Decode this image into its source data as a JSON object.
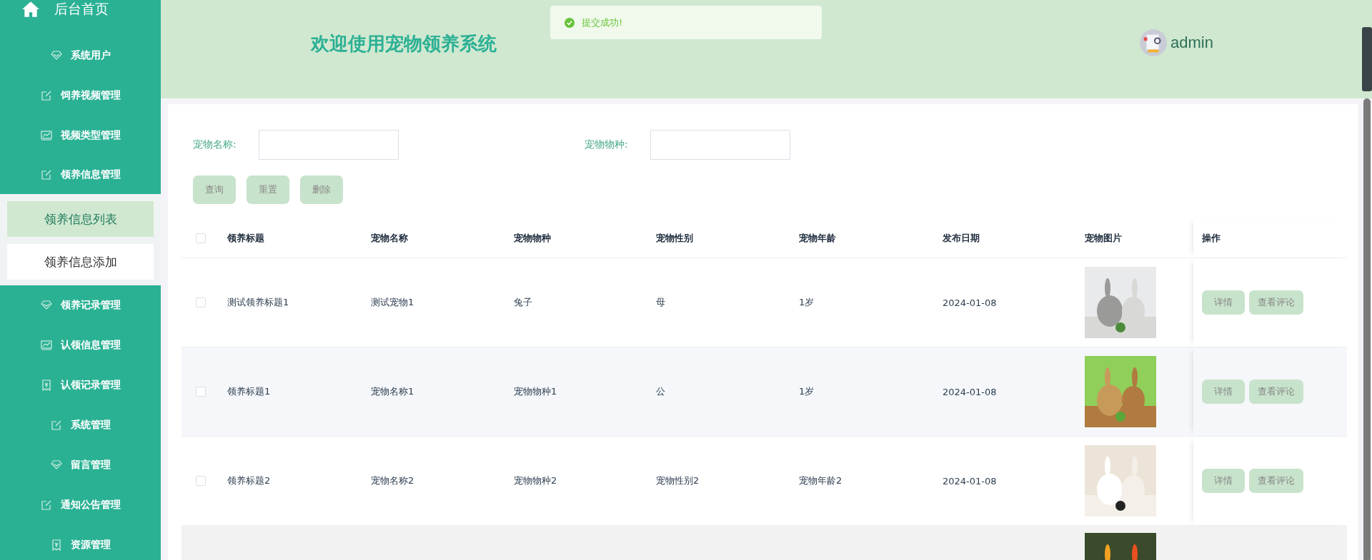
{
  "sidebar": {
    "home": "后台首页",
    "items": [
      {
        "label": "系统用户",
        "kind": "diamond",
        "expanded": false
      },
      {
        "label": "饲养视频管理",
        "kind": "edit",
        "expanded": false
      },
      {
        "label": "视频类型管理",
        "kind": "chart",
        "expanded": false
      },
      {
        "label": "领养信息管理",
        "kind": "edit",
        "expanded": true,
        "children": [
          {
            "label": "领养信息列表",
            "selected": true
          },
          {
            "label": "领养信息添加",
            "selected": false
          }
        ]
      },
      {
        "label": "领养记录管理",
        "kind": "diamond",
        "expanded": false
      },
      {
        "label": "认领信息管理",
        "kind": "chart",
        "expanded": false
      },
      {
        "label": "认领记录管理",
        "kind": "receipt",
        "expanded": false
      },
      {
        "label": "系统管理",
        "kind": "edit",
        "expanded": false
      },
      {
        "label": "留言管理",
        "kind": "diamond",
        "expanded": false
      },
      {
        "label": "通知公告管理",
        "kind": "edit",
        "expanded": false
      },
      {
        "label": "资源管理",
        "kind": "receipt",
        "expanded": false
      }
    ]
  },
  "header": {
    "title": "欢迎使用宠物领养系统",
    "user": "admin"
  },
  "toast": {
    "message": "提交成功!"
  },
  "search": {
    "fields": [
      {
        "label": "宠物名称:"
      },
      {
        "label": "宠物物种:"
      }
    ],
    "buttons": [
      "查询",
      "重置",
      "删除"
    ]
  },
  "table": {
    "select_all": {
      "checked": false
    },
    "columns": [
      "领养标题",
      "宠物名称",
      "宠物物种",
      "宠物性别",
      "宠物年龄",
      "发布日期",
      "宠物图片",
      "操作"
    ],
    "rows": [
      {
        "checked": false,
        "cells": [
          "测试领养标题1",
          "测试宠物1",
          "兔子",
          "母",
          "1岁",
          "2024-01-08"
        ],
        "image": {
          "kind": "picture"
        },
        "actions": [
          "详情",
          "查看评论"
        ]
      },
      {
        "checked": false,
        "cells": [
          "领养标题1",
          "宠物名称1",
          "宠物物种1",
          "公",
          "1岁",
          "2024-01-08"
        ],
        "image": {
          "kind": "picture"
        },
        "actions": [
          "详情",
          "查看评论"
        ]
      },
      {
        "checked": false,
        "cells": [
          "领养标题2",
          "宠物名称2",
          "宠物物种2",
          "宠物性别2",
          "宠物年龄2",
          "2024-01-08"
        ],
        "image": {
          "kind": "picture"
        },
        "actions": [
          "详情",
          "查看评论"
        ]
      },
      {
        "image": {
          "kind": "picture"
        }
      }
    ]
  }
}
